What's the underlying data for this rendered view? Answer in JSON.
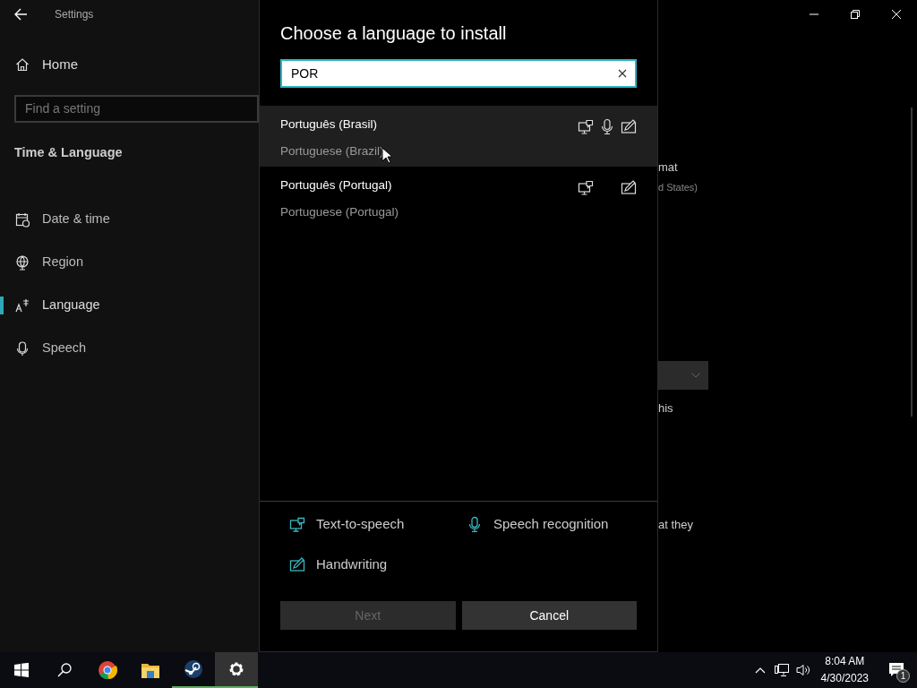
{
  "window": {
    "title": "Settings"
  },
  "sidebar": {
    "home": "Home",
    "search": {
      "placeholder": "Find a setting"
    },
    "section": "Time & Language",
    "items": [
      {
        "label": "Date & time",
        "selected": false
      },
      {
        "label": "Region",
        "selected": false
      },
      {
        "label": "Language",
        "selected": true
      },
      {
        "label": "Speech",
        "selected": false
      }
    ]
  },
  "background_fragments": [
    "mat",
    "d States)",
    "his",
    "at they"
  ],
  "dialog": {
    "title": "Choose a language to install",
    "search": {
      "value": "POR"
    },
    "languages": [
      {
        "name": "Português (Brasil)",
        "english": "Portuguese (Brazil)",
        "selected": true,
        "text_to_speech": true,
        "speech_recognition": true,
        "handwriting": true
      },
      {
        "name": "Português (Portugal)",
        "english": "Portuguese (Portugal)",
        "selected": false,
        "text_to_speech": true,
        "speech_recognition": false,
        "handwriting": true
      }
    ],
    "legend": [
      "Text-to-speech",
      "Speech recognition",
      "Handwriting"
    ],
    "buttons": [
      {
        "label": "Next",
        "disabled": true
      },
      {
        "label": "Cancel",
        "disabled": false
      }
    ]
  },
  "taskbar": {
    "apps": [
      {
        "running": false,
        "active": false
      },
      {
        "running": false,
        "active": false
      },
      {
        "running": true,
        "active": false
      },
      {
        "running": true,
        "active": true
      }
    ],
    "clock": {
      "time": "8:04 AM",
      "date": "4/30/2023"
    },
    "notifications": "1"
  }
}
